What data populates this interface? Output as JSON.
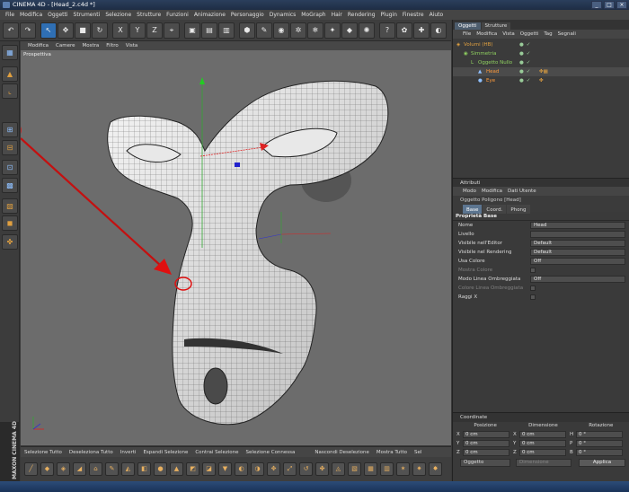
{
  "window": {
    "title": "CINEMA 4D - [Head_2.c4d *]"
  },
  "menubar": [
    "File",
    "Modifica",
    "Oggetti",
    "Strumenti",
    "Selezione",
    "Strutture",
    "Funzioni",
    "Animazione",
    "Personaggio",
    "Dynamics",
    "MoGraph",
    "Hair",
    "Rendering",
    "Plugin",
    "Finestre",
    "Aiuto"
  ],
  "toolbar": {
    "axis_x": "X",
    "axis_y": "Y",
    "axis_z": "Z"
  },
  "viewport": {
    "menu": [
      "Modifica",
      "Camere",
      "Mostra",
      "Filtro",
      "Vista"
    ],
    "label": "Prospettiva"
  },
  "bottom_selection": [
    "Selezione Tutto",
    "Deseleziona Tutto",
    "Inverti",
    "Espandi Selezione",
    "Contrai Selezione",
    "Selezione Connessa",
    "Nascondi Deselezione",
    "Mostra Tutto",
    "Sel"
  ],
  "objects_panel": {
    "tabs": [
      "Oggetti",
      "Strutture"
    ],
    "menu": [
      "File",
      "Modifica",
      "Vista",
      "Oggetti",
      "Tag",
      "Segnali"
    ],
    "items": [
      {
        "name": "Volumi (HB)",
        "color": "#e0a040"
      },
      {
        "name": "Simmetria",
        "color": "#8fd060"
      },
      {
        "name": "Oggetto Nullo",
        "color": "#8fd060"
      },
      {
        "name": "Head",
        "color": "#ff9a3a"
      },
      {
        "name": "Eye",
        "color": "#ff9a3a"
      }
    ]
  },
  "attributes_panel": {
    "title": "Attributi",
    "menu": [
      "Modo",
      "Modifica",
      "Dati Utente"
    ],
    "object_label": "Oggetto Poligono [Head]",
    "tabs": [
      "Base",
      "Coord.",
      "Phong"
    ],
    "section_title": "Proprietà Base",
    "rows": [
      {
        "label": "Nome",
        "value": "Head"
      },
      {
        "label": "Livello",
        "value": ""
      },
      {
        "label": "Visibile nell'Editor",
        "value": "Default"
      },
      {
        "label": "Visibile nel Rendering",
        "value": "Default"
      },
      {
        "label": "Usa Colore",
        "value": "Off"
      },
      {
        "label": "Mostra Colore",
        "value": ""
      },
      {
        "label": "Modo Linea Ombreggiata",
        "value": "Off"
      },
      {
        "label": "Colore Linea Ombreggiata",
        "value": ""
      },
      {
        "label": "Raggi X",
        "value": ""
      }
    ]
  },
  "coordinates_panel": {
    "title": "Coordinate",
    "headers": [
      "Posizione",
      "Dimensione",
      "Rotazione"
    ],
    "rows": [
      {
        "axis": "X",
        "pos": "0 cm",
        "dim_axis": "X",
        "dim": "0 cm",
        "rot_axis": "H",
        "rot": "0 °"
      },
      {
        "axis": "Y",
        "pos": "0 cm",
        "dim_axis": "Y",
        "dim": "0 cm",
        "rot_axis": "P",
        "rot": "0 °"
      },
      {
        "axis": "Z",
        "pos": "0 cm",
        "dim_axis": "Z",
        "dim": "0 cm",
        "rot_axis": "B",
        "rot": "0 °"
      }
    ],
    "mode": "Oggetto",
    "size_mode": "Dimensione",
    "apply": "Applica"
  },
  "brand": "MAXON CINEMA 4D",
  "colors": {
    "annotation": "#e01010",
    "selection": "#2f6fb4"
  }
}
